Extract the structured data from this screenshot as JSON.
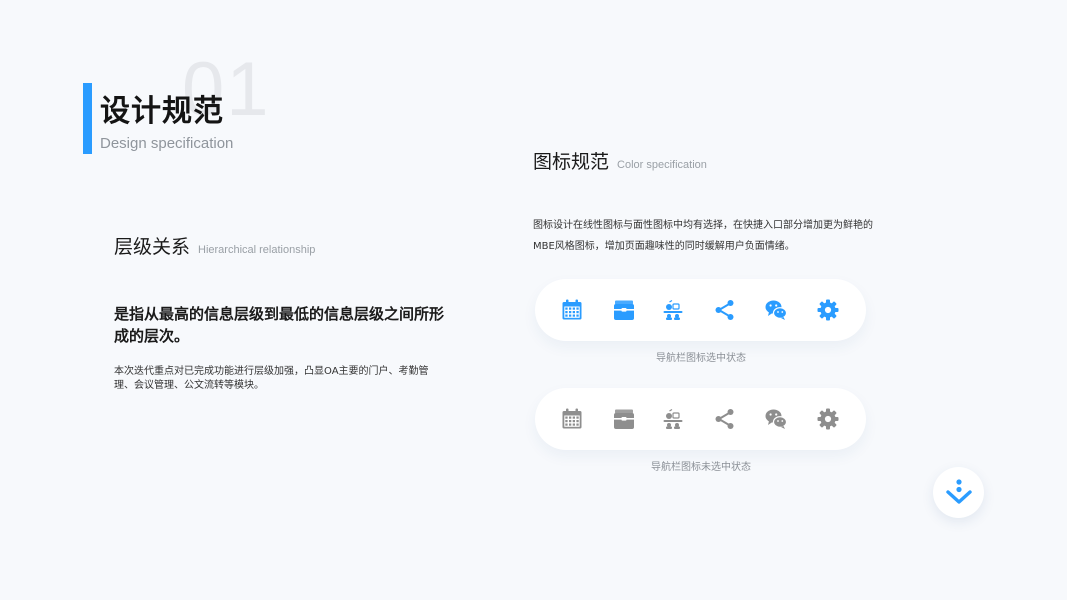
{
  "header": {
    "number": "01",
    "title": "设计规范",
    "subtitle": "Design specification"
  },
  "hierarchy": {
    "title": "层级关系",
    "title_en": "Hierarchical relationship",
    "lead": "是指从最高的信息层级到最低的信息层级之间所形成的层次。",
    "body": "本次迭代重点对已完成功能进行层级加强，凸显OA主要的门户、考勤管理、会议管理、公文流转等模块。"
  },
  "icons_spec": {
    "title": "图标规范",
    "title_en": "Color specification",
    "body": "图标设计在线性图标与面性图标中均有选择，在快捷入口部分增加更为鲜艳的MBE风格图标，增加页面趣味性的同时缓解用户负面情绪。",
    "active_label": "导航栏图标选中状态",
    "inactive_label": "导航栏图标未选中状态",
    "icons": [
      "calendar-icon",
      "briefcase-icon",
      "meeting-icon",
      "share-icon",
      "wechat-icon",
      "gear-icon"
    ]
  },
  "colors": {
    "accent": "#2a9cff",
    "icon_active": "#2a9cff",
    "icon_inactive": "#8e8e8e"
  }
}
